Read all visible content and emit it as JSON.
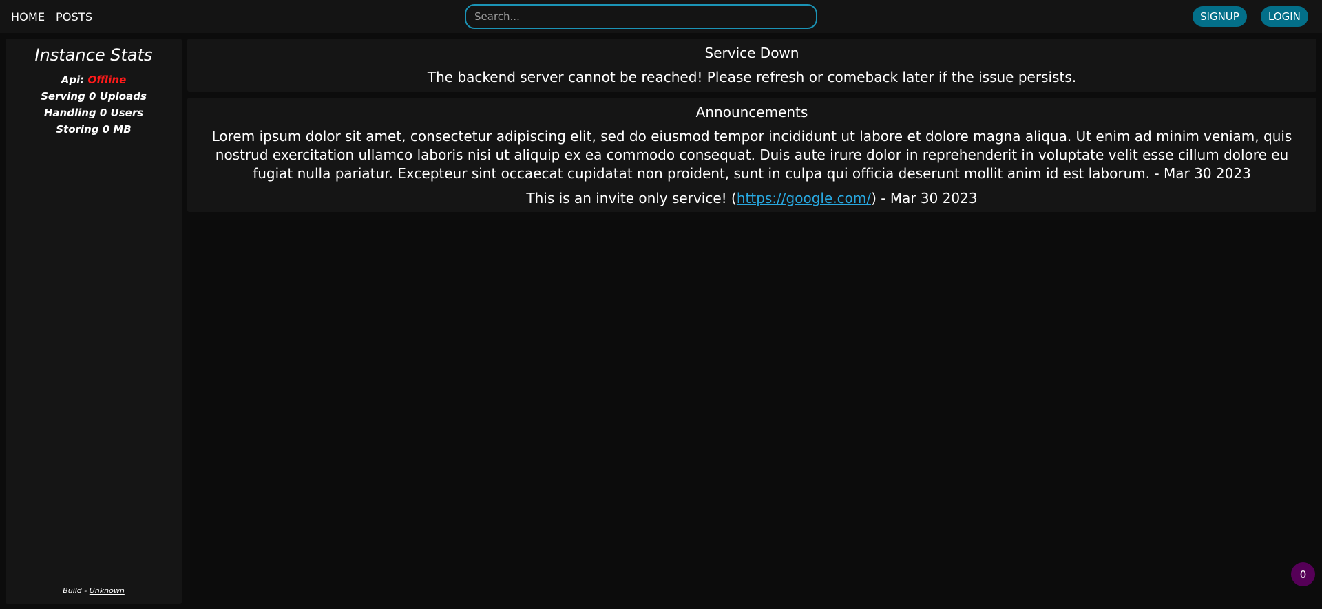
{
  "nav": {
    "home_label": "HOME",
    "posts_label": "POSTS",
    "search_placeholder": "Search...",
    "signup_label": "SIGNUP",
    "login_label": "LOGIN"
  },
  "sidebar": {
    "title": "Instance Stats",
    "api_label": "Api:",
    "api_status": "Offline",
    "uploads": "Serving 0 Uploads",
    "users": "Handling 0 Users",
    "storage": "Storing 0 MB",
    "build_prefix": "Build - ",
    "build_value": "Unknown"
  },
  "service_down": {
    "title": "Service Down",
    "message": "The backend server cannot be reached! Please refresh or comeback later if the issue persists."
  },
  "announcements": {
    "title": "Announcements",
    "items": [
      {
        "text": "Lorem ipsum dolor sit amet, consectetur adipiscing elit, sed do eiusmod tempor incididunt ut labore et dolore magna aliqua. Ut enim ad minim veniam, quis nostrud exercitation ullamco laboris nisi ut aliquip ex ea commodo consequat. Duis aute irure dolor in reprehenderit in voluptate velit esse cillum dolore eu fugiat nulla pariatur. Excepteur sint occaecat cupidatat non proident, sunt in culpa qui officia deserunt mollit anim id est laborum. - Mar 30 2023"
      },
      {
        "text_before": "This is an invite only service! (",
        "link": "https://google.com/",
        "text_after": ") - Mar 30 2023"
      }
    ]
  },
  "notification_count": "0",
  "colors": {
    "accent": "#1b93b5",
    "button": "#036f89",
    "offline": "#ff1a1a",
    "badge": "#550057"
  }
}
